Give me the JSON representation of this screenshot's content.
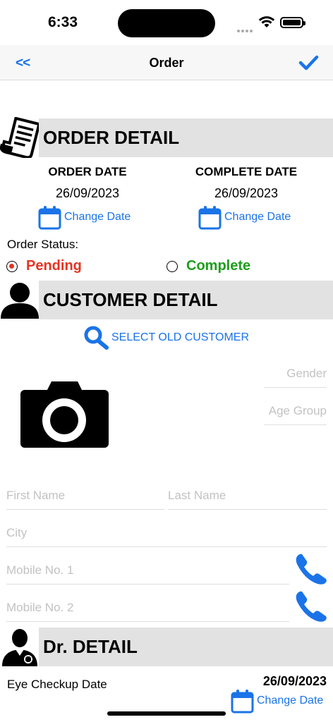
{
  "status_bar": {
    "time": "6:33"
  },
  "nav": {
    "back_label": "<<",
    "title": "Order"
  },
  "order_detail": {
    "title": "ORDER DETAIL",
    "order_date_label": "ORDER DATE",
    "order_date_value": "26/09/2023",
    "complete_date_label": "COMPLETE DATE",
    "complete_date_value": "26/09/2023",
    "change_date_label": "Change Date",
    "status_label": "Order Status:",
    "status_options": [
      {
        "label": "Pending",
        "selected": true,
        "color": "#e63322"
      },
      {
        "label": "Complete",
        "selected": false,
        "color": "#1e9e1e"
      }
    ]
  },
  "customer_detail": {
    "title": "CUSTOMER DETAIL",
    "select_old_customer_label": "SELECT OLD CUSTOMER",
    "gender_placeholder": "Gender",
    "age_group_placeholder": "Age Group",
    "first_name_placeholder": "First Name",
    "last_name_placeholder": "Last Name",
    "city_placeholder": "City",
    "mobile1_placeholder": "Mobile No. 1",
    "mobile2_placeholder": "Mobile No. 2"
  },
  "dr_detail": {
    "title": "Dr. DETAIL",
    "eye_checkup_label": "Eye Checkup Date",
    "eye_checkup_value": "26/09/2023",
    "change_date_label": "Change Date"
  },
  "colors": {
    "accent": "#1a73e8",
    "pending": "#e63322",
    "complete": "#1e9e1e",
    "section_bg": "#e2e2e2"
  }
}
